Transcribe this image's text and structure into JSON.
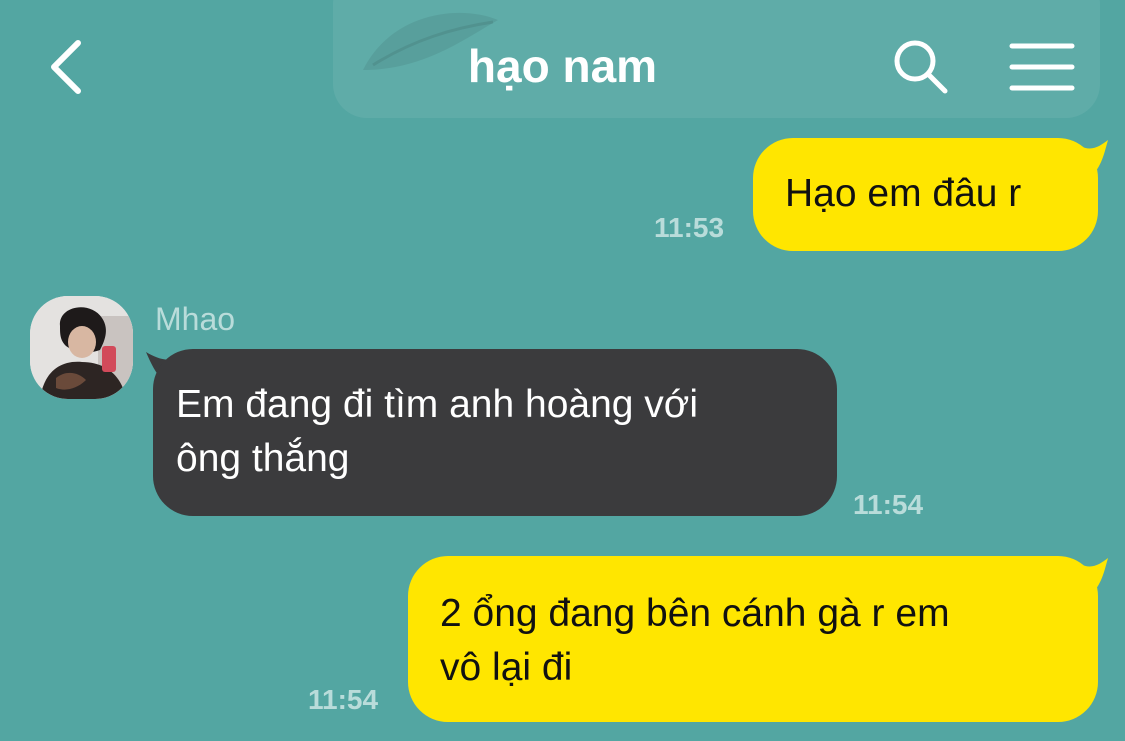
{
  "app": {
    "chat_title": "hạo nam"
  },
  "header": {
    "back_icon": "chevron-left-icon",
    "search_icon": "search-icon",
    "menu_icon": "hamburger-menu-icon"
  },
  "colors": {
    "background": "#53a6a2",
    "my_bubble": "#ffe600",
    "their_bubble": "#3b3b3d",
    "timestamp": "#b9dcda",
    "header_text": "#ffffff"
  },
  "messages": [
    {
      "sender": "me",
      "text": "Hạo em đâu r",
      "time": "11:53"
    },
    {
      "sender": "them",
      "sender_name": "Mhao",
      "text_lines": [
        "Em đang đi tìm anh hoàng với",
        "ông thắng"
      ],
      "time": "11:54"
    },
    {
      "sender": "me",
      "text_lines": [
        "2 ổng đang bên cánh gà r em",
        "vô lại đi"
      ],
      "time": "11:54"
    }
  ]
}
